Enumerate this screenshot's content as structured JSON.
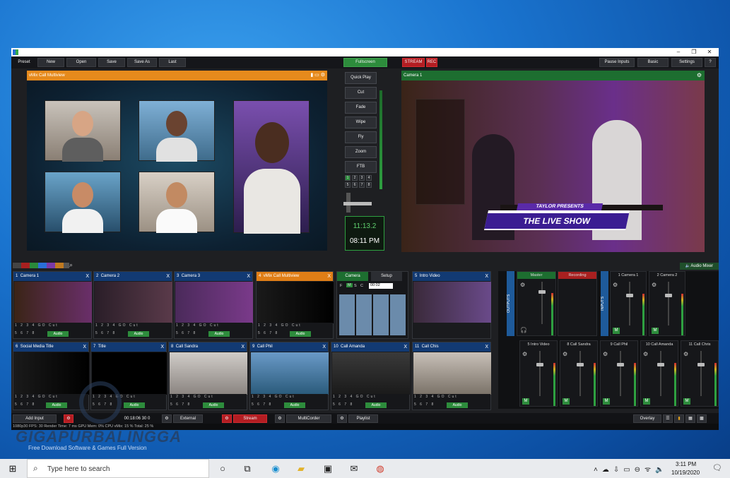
{
  "toolbar": {
    "preset": "Preset",
    "new": "New",
    "open": "Open",
    "save": "Save",
    "save_as": "Save As",
    "last": "Last",
    "fullscreen": "Fullscreen",
    "stream": "STREAM",
    "rec": "REC",
    "pause_inputs": "Pause Inputs",
    "basic": "Basic",
    "settings": "Settings",
    "help": "?"
  },
  "preview": {
    "title": "vMix Call Multiview"
  },
  "output": {
    "title": "Camera 1",
    "lower_third_top": "TAYLOR PRESENTS",
    "lower_third_main": "THE LIVE SHOW"
  },
  "transitions": {
    "quick_play": "Quick Play",
    "cut": "Cut",
    "fade": "Fade",
    "wipe": "Wipe",
    "fly": "Fly",
    "zoom": "Zoom",
    "ftb": "FTB",
    "numbers": [
      "1",
      "2",
      "3",
      "4",
      "5",
      "6",
      "7",
      "8"
    ]
  },
  "clock": {
    "countdown": "11:13.2",
    "time": "08:11 PM"
  },
  "audio_mixer_label": "Audio Mixer",
  "inputs_row1": [
    {
      "num": "1",
      "name": "Camera 1",
      "color": "#123a73"
    },
    {
      "num": "2",
      "name": "Camera 2",
      "color": "#123a73"
    },
    {
      "num": "3",
      "name": "Camera 3",
      "color": "#123a73"
    },
    {
      "num": "4",
      "name": "vMix Call Multiview",
      "color": "#e07e16"
    }
  ],
  "call_panel": {
    "tab_camera": "Camera",
    "tab_setup": "Setup",
    "f": "F",
    "m": "M",
    "s": "S",
    "c": "C",
    "time": "00:02"
  },
  "input_intro": {
    "num": "5",
    "name": "Intro Video"
  },
  "inputs_row2": [
    {
      "num": "6",
      "name": "Social Media Title"
    },
    {
      "num": "7",
      "name": "Title"
    },
    {
      "num": "8",
      "name": "Call Sandra"
    },
    {
      "num": "9",
      "name": "Call Phil"
    },
    {
      "num": "10",
      "name": "Call Amanda"
    },
    {
      "num": "11",
      "name": "Call Chis"
    }
  ],
  "controls": {
    "row1": "1 2 3 4 GO Cut",
    "row2": "5 6 7 8",
    "audio": "Audio",
    "close": "X"
  },
  "mixer": {
    "master": "Master",
    "recording": "Recording",
    "outputs": "OUTPUTS",
    "inputs": "INPUTS",
    "top_channels": [
      "1 Camera 1",
      "2 Camera 2"
    ],
    "bottom_channels": [
      "5 Intro Video",
      "8 Call Sandra",
      "9 Call Phil",
      "10 Call Amanda",
      "11 Call Chris"
    ],
    "m": "M"
  },
  "bottom": {
    "add_input": "Add Input",
    "rec_time": "00:18:06 30 0",
    "external": "External",
    "stream": "Stream",
    "multicorder": "MultiCorder",
    "playlist": "Playlist",
    "overlay": "Overlay"
  },
  "status": "1080p30  FPS: 30  Render Time: 7 ms  GPU Mem: 0%  CPU vMix: 15 %  Total: 25 %",
  "watermark": {
    "brand": "GIGAPURBALINGGA",
    "tagline": "Free Download Software & Games Full Version"
  },
  "taskbar": {
    "search_placeholder": "Type here to search",
    "time": "3:11 PM",
    "date": "10/19/2020"
  }
}
